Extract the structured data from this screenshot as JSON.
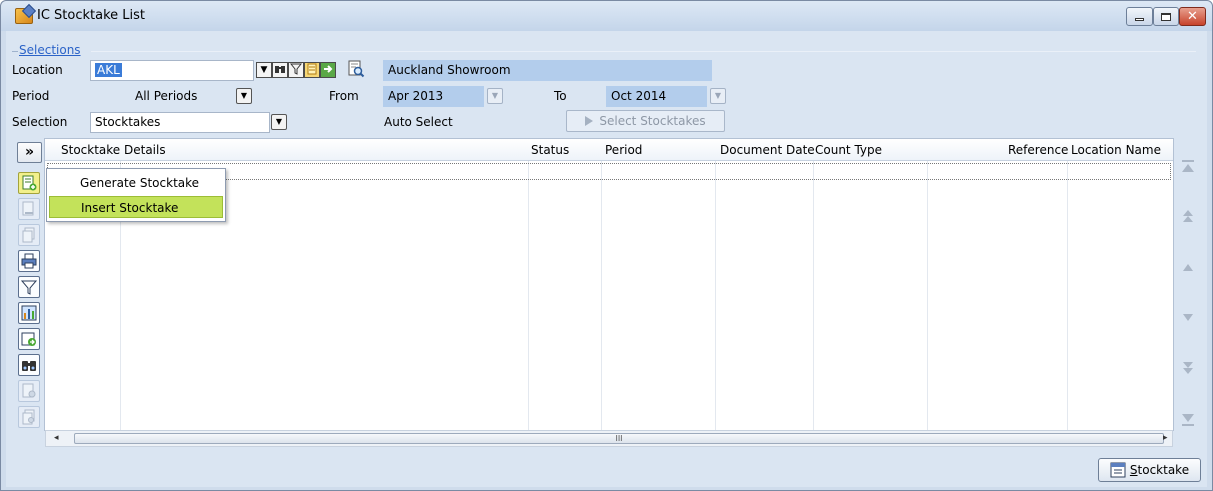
{
  "window": {
    "title": "IC Stocktake List",
    "icon": "stocktake-app-icon"
  },
  "selections": {
    "legend": "Selections",
    "location_label": "Location",
    "location_value": "AKL",
    "location_name": "Auckland Showroom",
    "period_label": "Period",
    "period_value": "All Periods",
    "from_label": "From",
    "from_value": "Apr 2013",
    "to_label": "To",
    "to_value": "Oct 2014",
    "selection_label": "Selection",
    "selection_value": "Stocktakes",
    "auto_select_label": "Auto Select",
    "select_button": "Select Stocktakes"
  },
  "grid": {
    "columns": [
      "Stocktake Details",
      "Status",
      "Period",
      "Document Date",
      "Count Type",
      "Reference",
      "Location Name"
    ],
    "rows": []
  },
  "expand_button": "»",
  "context_menu": {
    "items": [
      {
        "label": "Generate Stocktake",
        "highlighted": false
      },
      {
        "label": "Insert Stocktake",
        "highlighted": true
      }
    ]
  },
  "toolbar_icons": [
    "add-stocktake-icon",
    "edit-icon",
    "copy-icon",
    "print-icon",
    "filter-icon",
    "chart-icon",
    "export-icon",
    "find-icon",
    "document-icon",
    "duplicate-icon"
  ],
  "hscroll_grip": "III",
  "bottom_button": {
    "accel": "S",
    "rest": "tocktake"
  },
  "colors": {
    "window_bg": "#dae5f2",
    "field_highlight": "#b3cdec",
    "menu_highlight": "#c3e25a",
    "legend_link": "#2b63c8"
  }
}
